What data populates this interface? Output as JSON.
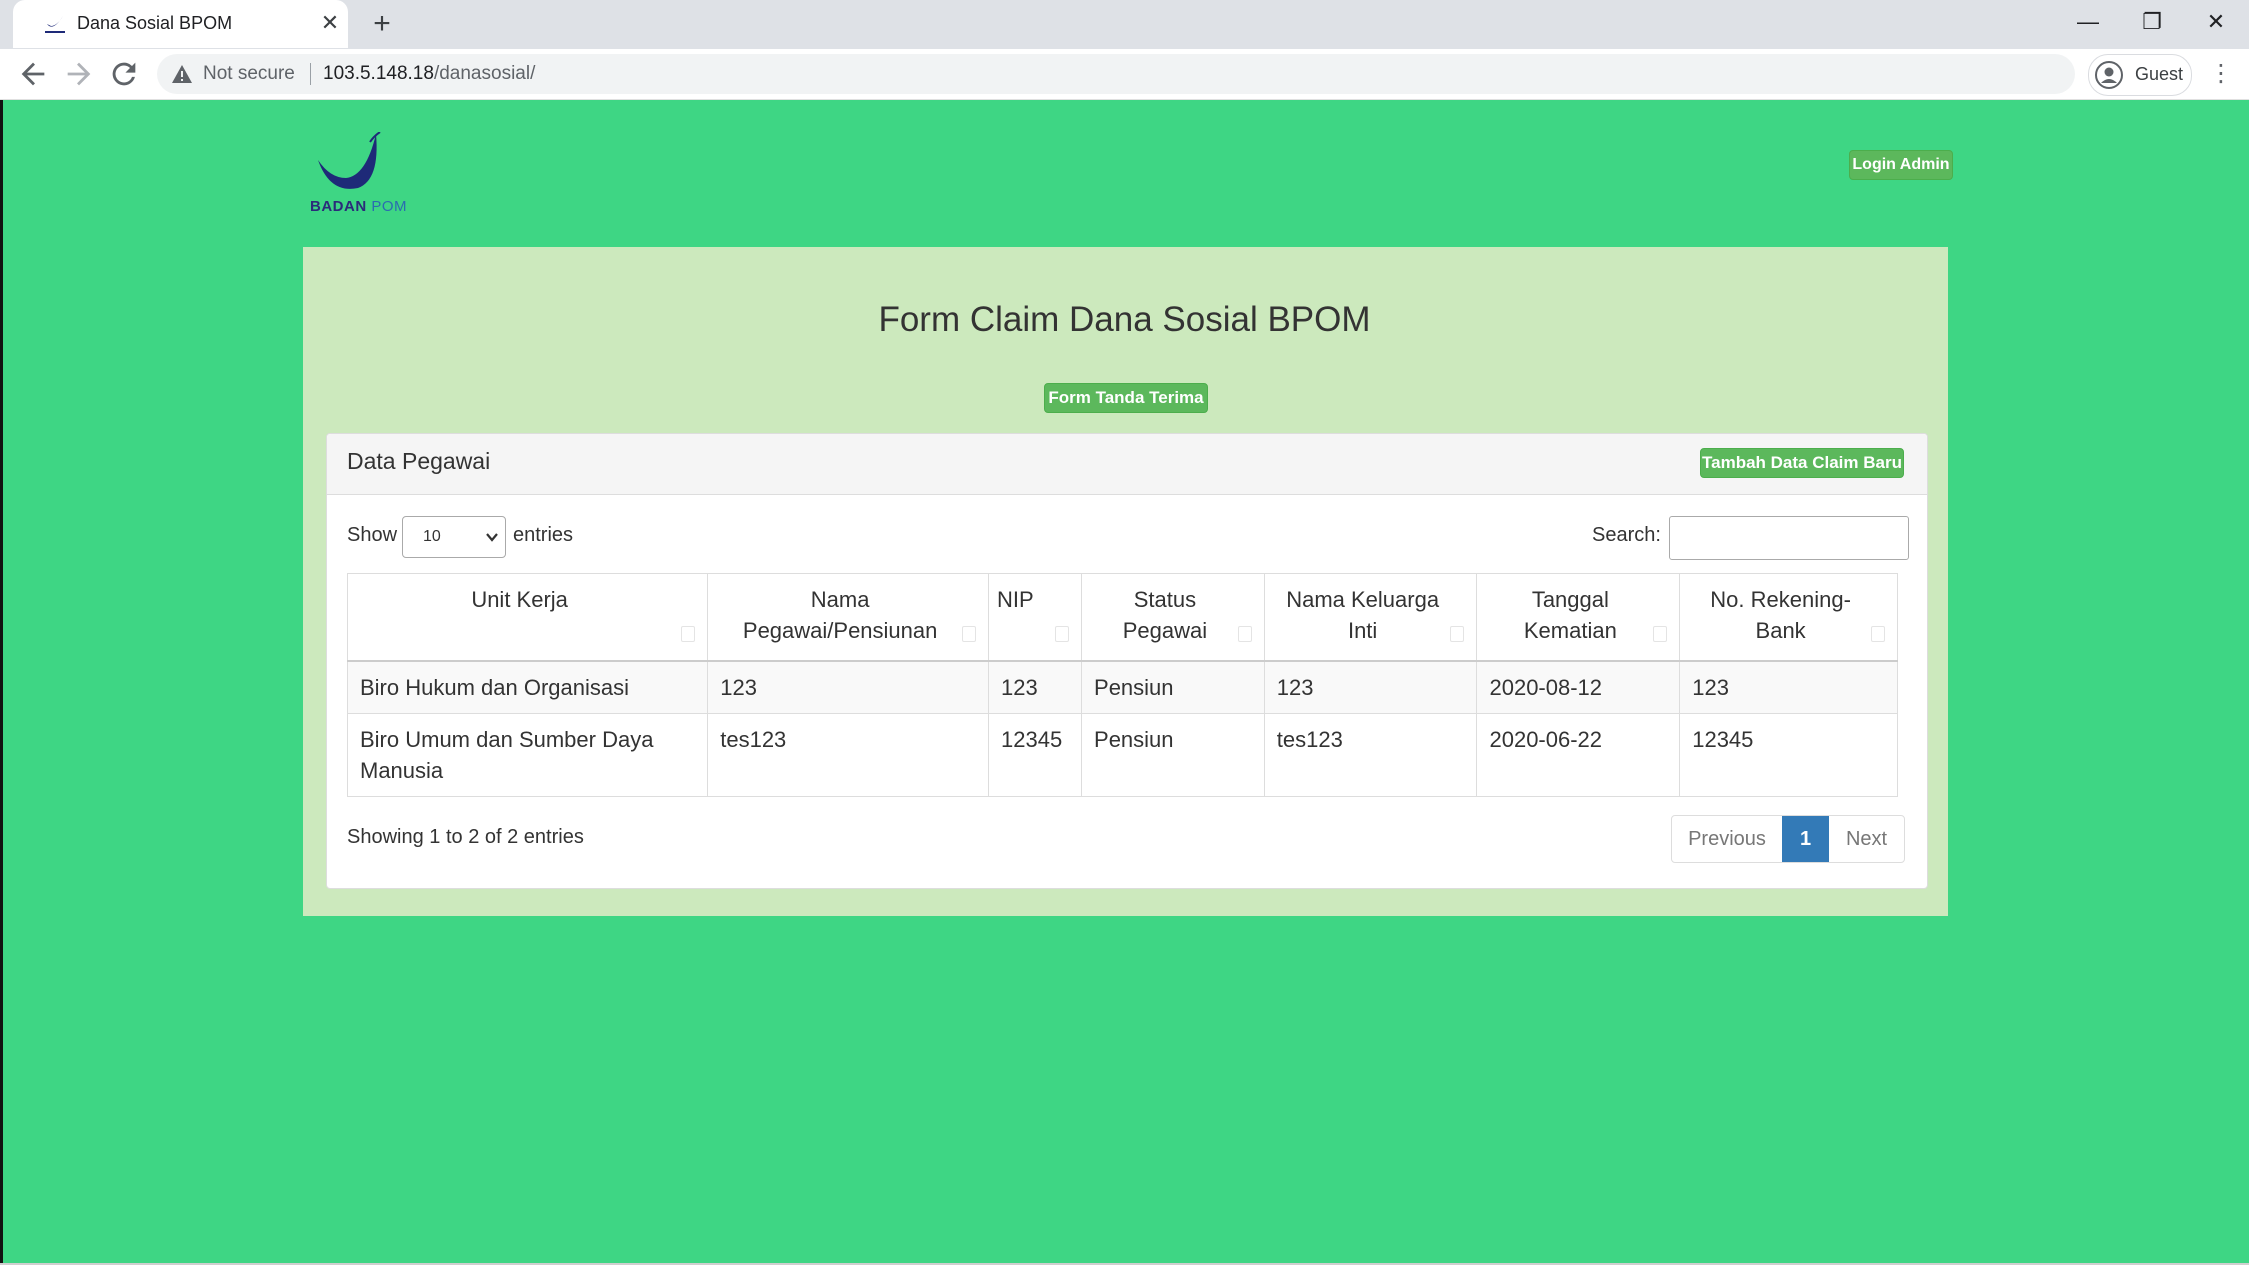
{
  "browser": {
    "tab_title": "Dana Sosial BPOM",
    "tab_close": "✕",
    "new_tab": "+",
    "not_secure": "Not secure",
    "url_host": "103.5.148.18",
    "url_path": "/danasosial/",
    "profile": "Guest",
    "window": {
      "minimize": "—",
      "restore": "❐",
      "close": "✕"
    }
  },
  "header": {
    "logo_badan": "BADAN",
    "logo_pom": "POM",
    "login_button": "Login Admin"
  },
  "page": {
    "title": "Form Claim Dana Sosial BPOM",
    "form_button": "Form Tanda Terima"
  },
  "card": {
    "title": "Data Pegawai",
    "add_button": "Tambah Data Claim Baru",
    "show_label": "Show",
    "entries_value": "10",
    "entries_label": "entries",
    "search_label": "Search:",
    "search_value": ""
  },
  "table": {
    "columns": [
      "Unit Kerja",
      "Nama Pegawai/Pensiunan",
      "NIP",
      "Status Pegawai",
      "Nama Keluarga Inti",
      "Tanggal Kematian",
      "No. Rekening-Bank"
    ],
    "rows": [
      [
        "Biro Hukum dan Organisasi",
        "123",
        "123",
        "Pensiun",
        "123",
        "2020-08-12",
        "123"
      ],
      [
        "Biro Umum dan Sumber Daya Manusia",
        "tes123",
        "12345",
        "Pensiun",
        "tes123",
        "2020-06-22",
        "12345"
      ]
    ]
  },
  "footer": {
    "info": "Showing 1 to 2 of 2 entries",
    "previous": "Previous",
    "page": "1",
    "next": "Next"
  },
  "colors": {
    "page_bg": "#3ed684",
    "panel_bg": "#cce9bd",
    "button_green": "#5cb85c",
    "pager_active": "#337ab7"
  }
}
